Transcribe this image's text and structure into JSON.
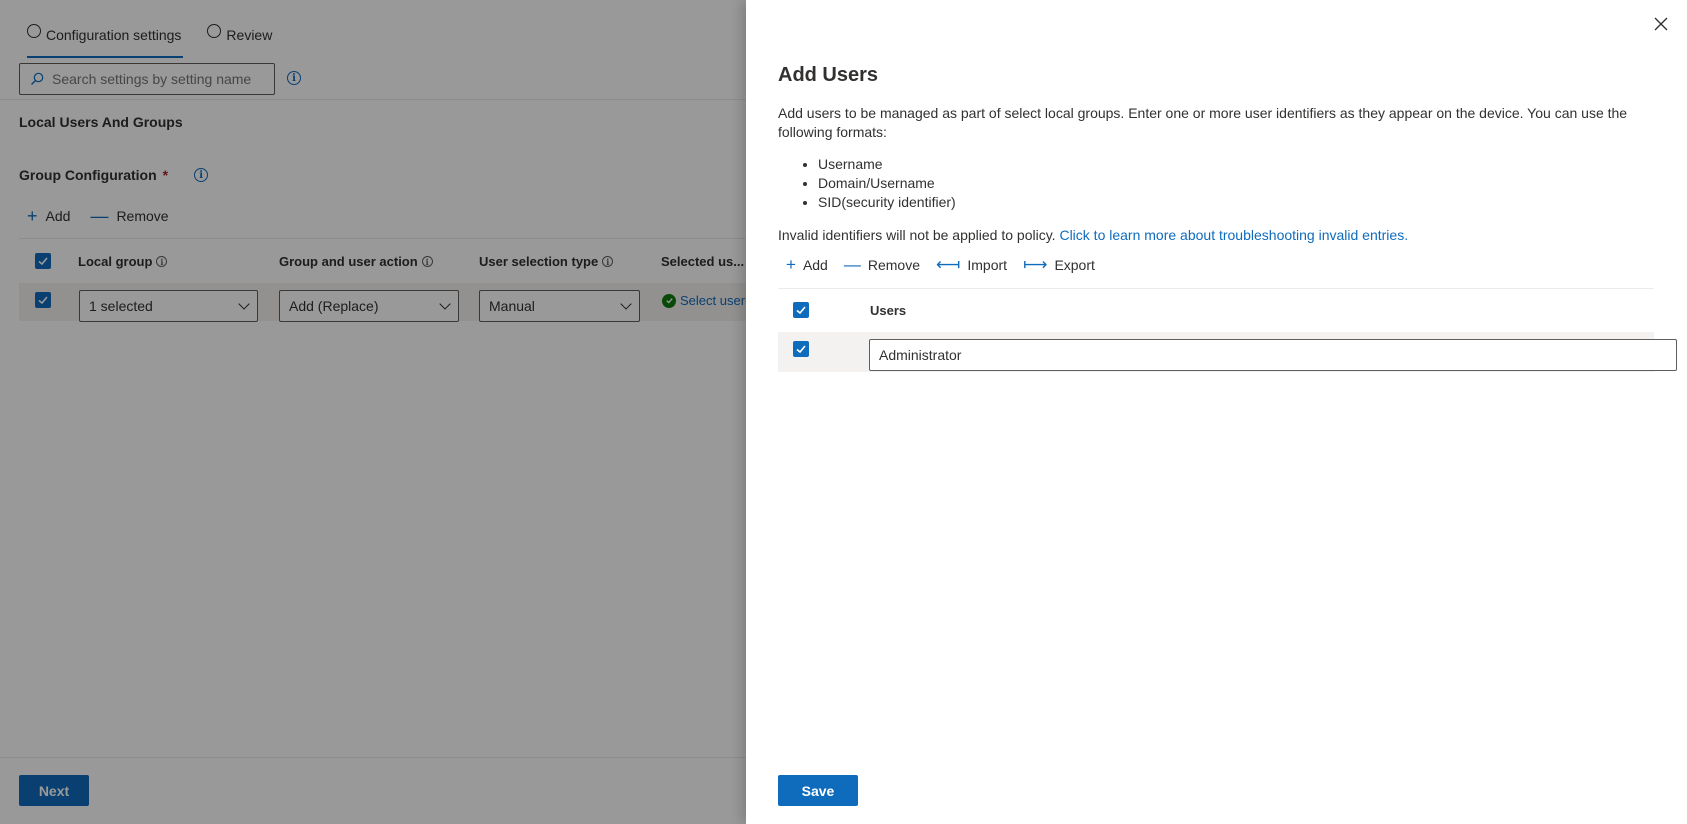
{
  "background": {
    "tabs": [
      {
        "label": "Configuration settings",
        "active": true
      },
      {
        "label": "Review",
        "active": false
      }
    ],
    "search": {
      "placeholder": "Search settings by setting name"
    },
    "section_title": "Local Users And Groups",
    "group_config": {
      "label": "Group Configuration",
      "required_marker": "*"
    },
    "toolbar": {
      "add_label": "Add",
      "remove_label": "Remove"
    },
    "table": {
      "columns": [
        "Local group",
        "Group and user action",
        "User selection type",
        "Selected us..."
      ],
      "row": {
        "local_group": "1 selected",
        "action": "Add (Replace)",
        "selection_type": "Manual",
        "selected_users": "Select user("
      }
    },
    "next_label": "Next"
  },
  "panel": {
    "title": "Add Users",
    "description": "Add users to be managed as part of select local groups. Enter one or more user identifiers as they appear on the device. You can use the following formats:",
    "formats": [
      "Username",
      "Domain/Username",
      "SID(security identifier)"
    ],
    "invalid_text": "Invalid identifiers will not be applied to policy.",
    "invalid_link": "Click to learn more about troubleshooting invalid entries.",
    "toolbar": {
      "add_label": "Add",
      "remove_label": "Remove",
      "import_label": "Import",
      "export_label": "Export"
    },
    "table": {
      "column": "Users",
      "rows": [
        {
          "value": "Administrator"
        }
      ]
    },
    "save_label": "Save"
  },
  "colors": {
    "accent": "#0f6cbd",
    "success": "#107c10",
    "required": "#a4262c"
  }
}
